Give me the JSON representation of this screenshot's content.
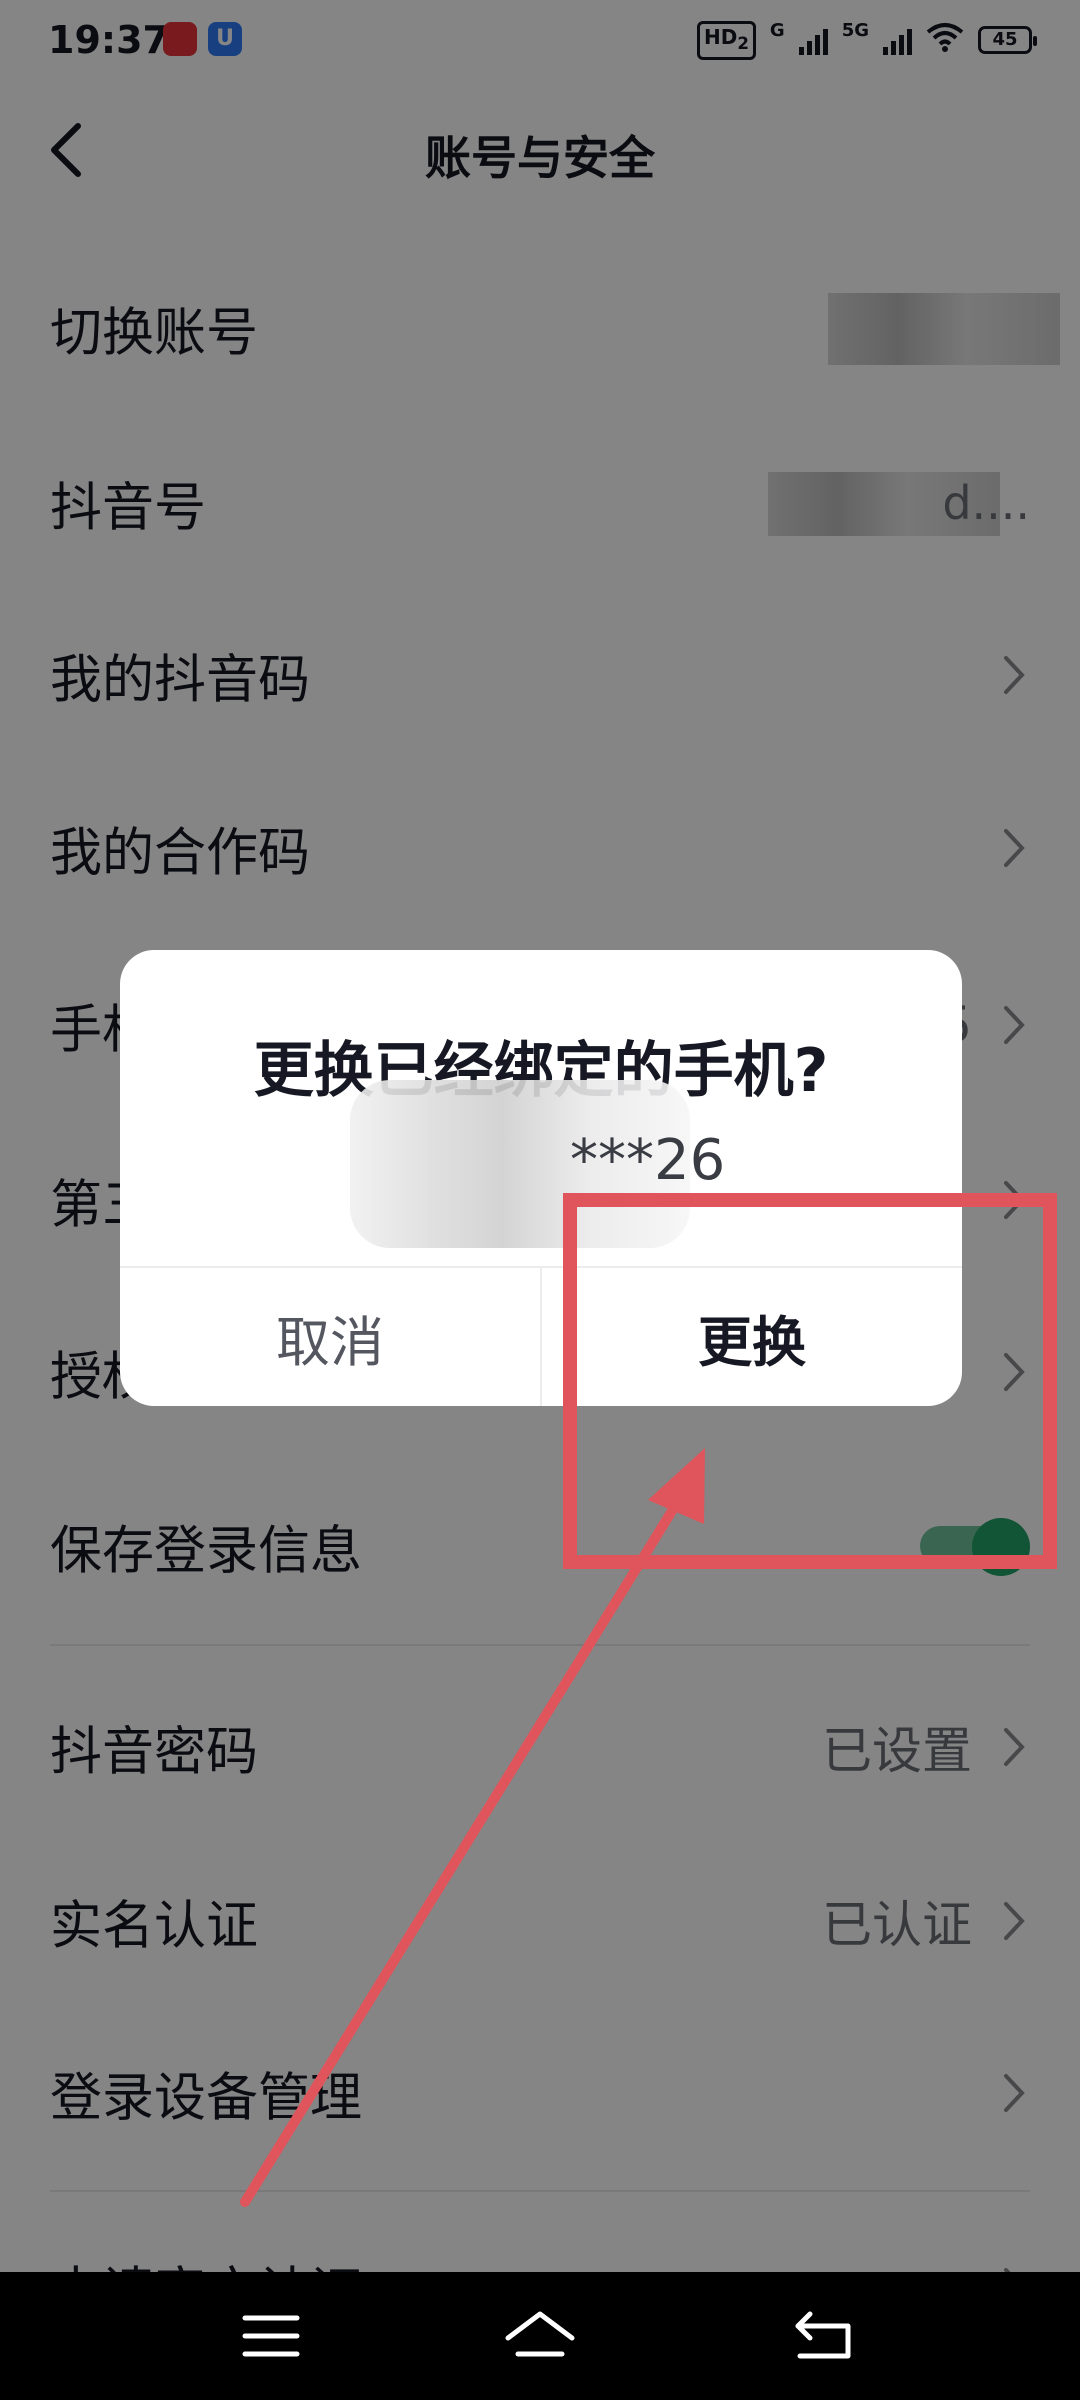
{
  "status_bar": {
    "time": "19:37",
    "hd_label": "HD",
    "hd_sub": "2",
    "net1": "G",
    "net2": "5G",
    "battery": "45"
  },
  "header": {
    "title": "账号与安全"
  },
  "rows": [
    {
      "label": "切换账号"
    },
    {
      "label": "抖音号",
      "value": "d...."
    },
    {
      "label": "我的抖音码"
    },
    {
      "label": "我的合作码"
    },
    {
      "label": "手机号",
      "value": "5"
    },
    {
      "label": "第三方账号绑定"
    },
    {
      "label": "授权管理"
    },
    {
      "label": "保存登录信息",
      "toggle": true
    },
    {
      "label": "抖音密码",
      "value": "已设置"
    },
    {
      "label": "实名认证",
      "value": "已认证"
    },
    {
      "label": "登录设备管理"
    },
    {
      "label": "申请官方认证"
    }
  ],
  "dialog": {
    "title": "更换已经绑定的手机?",
    "phone": "***26",
    "cancel_label": "取消",
    "confirm_label": "更换"
  },
  "colors": {
    "annotation": "#e0555c",
    "toggle_on": "#24a268"
  },
  "icons": {
    "back": "back-arrow-icon",
    "row_chevron": "chevron-right-icon",
    "nav_menu": "menu-icon",
    "nav_home": "home-icon",
    "nav_back": "return-icon"
  }
}
